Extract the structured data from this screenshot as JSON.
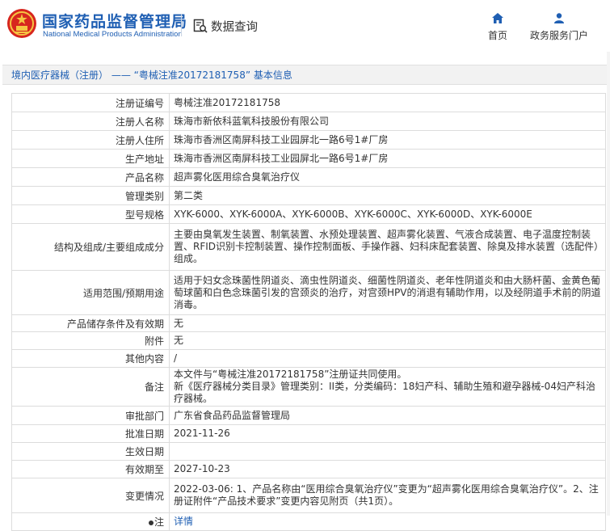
{
  "header": {
    "site_title_cn": "国家药品监督管理局",
    "site_title_en": "National Medical Products Administration",
    "query_label": "数据查询",
    "nav": [
      {
        "label": "首页",
        "icon": "home-icon"
      },
      {
        "label": "政务服务门户",
        "icon": "user-icon"
      }
    ]
  },
  "breadcrumb": "境内医疗器械（注册） —— “粤械注准20172181758” 基本信息",
  "rows": [
    {
      "label": "注册证编号",
      "value": "粤械注准20172181758"
    },
    {
      "label": "注册人名称",
      "value": "珠海市新依科蓝氧科技股份有限公司"
    },
    {
      "label": "注册人住所",
      "value": "珠海市香洲区南屏科技工业园屏北一路6号1#厂房"
    },
    {
      "label": "生产地址",
      "value": "珠海市香洲区南屏科技工业园屏北一路6号1#厂房"
    },
    {
      "label": "产品名称",
      "value": "超声雾化医用综合臭氧治疗仪"
    },
    {
      "label": "管理类别",
      "value": "第二类"
    },
    {
      "label": "型号规格",
      "value": "XYK-6000、XYK-6000A、XYK-6000B、XYK-6000C、XYK-6000D、XYK-6000E"
    },
    {
      "label": "结构及组成/主要组成成分",
      "value": "主要由臭氧发生装置、制氧装置、水预处理装置、超声雾化装置、气液合成装置、电子温度控制装置、RFID识别卡控制装置、操作控制面板、手操作器、妇科床配套装置、除臭及排水装置（选配件）组成。"
    },
    {
      "label": "适用范围/预期用途",
      "value": "适用于妇女念珠菌性阴道炎、滴虫性阴道炎、细菌性阴道炎、老年性阴道炎和由大肠杆菌、金黄色葡萄球菌和白色念珠菌引发的宫颈炎的治疗，对宫颈HPV的消退有辅助作用，以及经阴道手术前的阴道消毒。"
    },
    {
      "label": "产品储存条件及有效期",
      "value": "无"
    },
    {
      "label": "附件",
      "value": "无"
    },
    {
      "label": "其他内容",
      "value": "/"
    },
    {
      "label": "备注",
      "value": "本文件与“粤械注准20172181758”注册证共同使用。\n新《医疗器械分类目录》管理类别：II类，分类编码：18妇产科、辅助生殖和避孕器械-04妇产科治疗器械。"
    },
    {
      "label": "审批部门",
      "value": "广东省食品药品监督管理局"
    },
    {
      "label": "批准日期",
      "value": "2021-11-26"
    },
    {
      "label": "生效日期",
      "value": ""
    },
    {
      "label": "有效期至",
      "value": "2027-10-23"
    },
    {
      "label": "变更情况",
      "value": "2022-03-06: 1、产品名称由“医用综合臭氧治疗仪”变更为“超声雾化医用综合臭氧治疗仪”。2、注册证附件“产品技术要求”变更内容见附页（共1页）。"
    },
    {
      "label": "注",
      "value": "详情"
    }
  ],
  "colors": {
    "brand_blue": "#1f5fb3",
    "emblem_red": "#d7261e"
  }
}
